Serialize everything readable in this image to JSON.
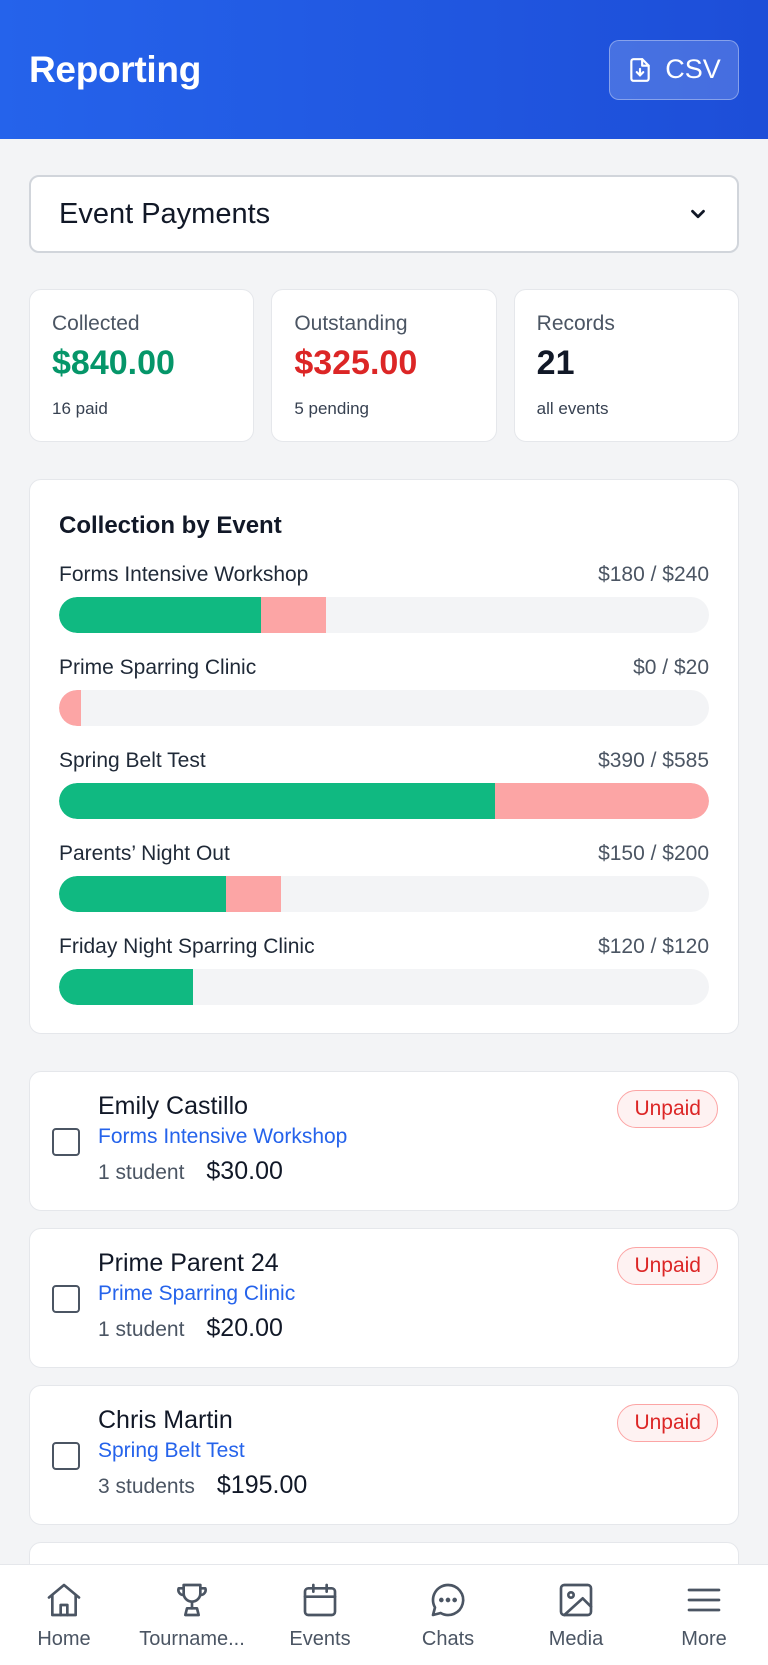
{
  "header": {
    "title": "Reporting",
    "csv_label": "CSV"
  },
  "filter": {
    "selected": "Event Payments"
  },
  "stats": [
    {
      "label": "Collected",
      "value": "$840.00",
      "sub": "16 paid"
    },
    {
      "label": "Outstanding",
      "value": "$325.00",
      "sub": "5 pending"
    },
    {
      "label": "Records",
      "value": "21",
      "sub": "all events"
    }
  ],
  "collection": {
    "title": "Collection by Event",
    "events": [
      {
        "name": "Forms Intensive Workshop",
        "amount": "$180 / $240",
        "paid_frac": 0.31,
        "owed_frac": 0.1
      },
      {
        "name": "Prime Sparring Clinic",
        "amount": "$0 / $20",
        "paid_frac": 0.0,
        "owed_frac": 0.034
      },
      {
        "name": "Spring Belt Test",
        "amount": "$390 / $585",
        "paid_frac": 0.67,
        "owed_frac": 0.33
      },
      {
        "name": "Parents’ Night Out",
        "amount": "$150 / $200",
        "paid_frac": 0.257,
        "owed_frac": 0.085
      },
      {
        "name": "Friday Night Sparring Clinic",
        "amount": "$120 / $120",
        "paid_frac": 0.206,
        "owed_frac": 0.0
      }
    ]
  },
  "records": [
    {
      "name": "Emily Castillo",
      "event": "Forms Intensive Workshop",
      "students": "1 student",
      "amount": "$30.00",
      "status": "Unpaid"
    },
    {
      "name": "Prime Parent 24",
      "event": "Prime Sparring Clinic",
      "students": "1 student",
      "amount": "$20.00",
      "status": "Unpaid"
    },
    {
      "name": "Chris Martin",
      "event": "Spring Belt Test",
      "students": "3 students",
      "amount": "$195.00",
      "status": "Unpaid"
    }
  ],
  "nav": [
    {
      "label": "Home",
      "icon": "home-icon"
    },
    {
      "label": "Tourname...",
      "icon": "trophy-icon"
    },
    {
      "label": "Events",
      "icon": "calendar-icon"
    },
    {
      "label": "Chats",
      "icon": "chat-icon"
    },
    {
      "label": "Media",
      "icon": "image-icon"
    },
    {
      "label": "More",
      "icon": "menu-icon"
    }
  ],
  "colors": {
    "header": "#2563eb",
    "paid": "#10b981",
    "owed": "#fca5a5",
    "collected": "#059669",
    "outstanding": "#dc2626",
    "link": "#2563eb"
  }
}
